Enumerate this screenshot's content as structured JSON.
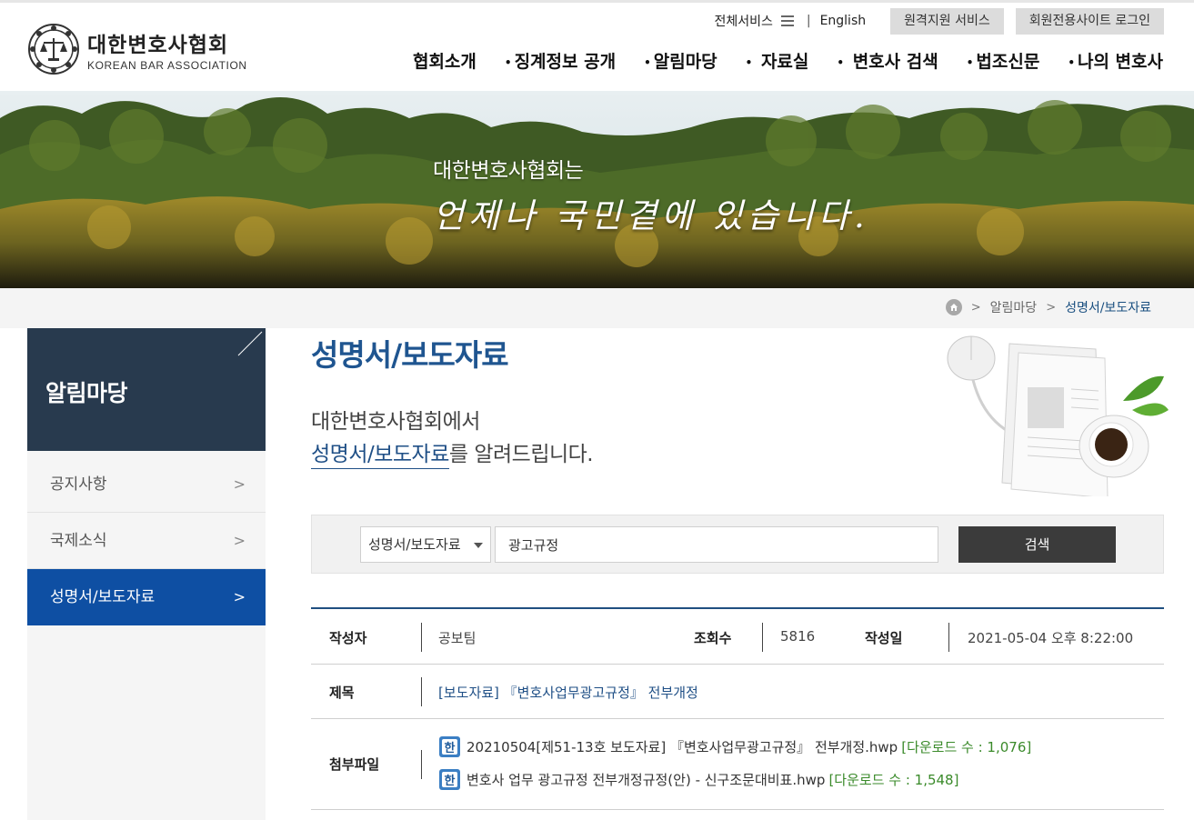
{
  "header": {
    "logo_ko": "대한변호사협회",
    "logo_en": "KOREAN BAR ASSOCIATION",
    "topbar": {
      "all_services": "전체서비스",
      "separator": "|",
      "english": "English",
      "remote_support": "원격지원 서비스",
      "member_login": "회원전용사이트 로그인"
    },
    "gnb": [
      {
        "label": "협회소개"
      },
      {
        "label": "징계정보 공개"
      },
      {
        "label": "알림마당"
      },
      {
        "label": "자료실"
      },
      {
        "label": "변호사 검색"
      },
      {
        "label": "법조신문"
      },
      {
        "label": "나의 변호사"
      }
    ],
    "gnb_bullet": "•"
  },
  "banner": {
    "line1": "대한변호사협회는",
    "line2": "언제나 국민곁에 있습니다."
  },
  "breadcrumb": {
    "sep": ">",
    "items": [
      "알림마당",
      "성명서/보도자료"
    ]
  },
  "lnb": {
    "title": "알림마당",
    "chevron": ">",
    "items": [
      {
        "label": "공지사항"
      },
      {
        "label": "국제소식"
      },
      {
        "label": "성명서/보도자료"
      }
    ]
  },
  "content": {
    "title": "성명서/보도자료",
    "intro_line1": "대한변호사협회에서",
    "intro_line2_highlight": "성명서/보도자료",
    "intro_line2_rest": "를 알려드립니다."
  },
  "search": {
    "select_value": "성명서/보도자료",
    "input_value": "광고규정",
    "button_label": "검색"
  },
  "detail": {
    "author_label": "작성자",
    "author": "공보팀",
    "views_label": "조회수",
    "views": "5816",
    "date_label": "작성일",
    "date": "2021-05-04 오후 8:22:00",
    "subject_label": "제목",
    "subject": "[보도자료] 『변호사업무광고규정』 전부개정",
    "attach_label": "첨부파일",
    "files": [
      {
        "name": "20210504[제51-13호 보도자료] 『변호사업무광고규정』 전부개정.hwp",
        "downloads": "[다운로드 수 : 1,076]"
      },
      {
        "name": "변호사 업무 광고규정 전부개정규정(안) - 신구조문대비표.hwp",
        "downloads": "[다운로드 수 : 1,548]"
      }
    ]
  },
  "colors": {
    "nav_dark": "#283a4e",
    "accent_blue": "#0e4fa3",
    "title_blue": "#1f5590",
    "download_green": "#3a8a2a"
  }
}
